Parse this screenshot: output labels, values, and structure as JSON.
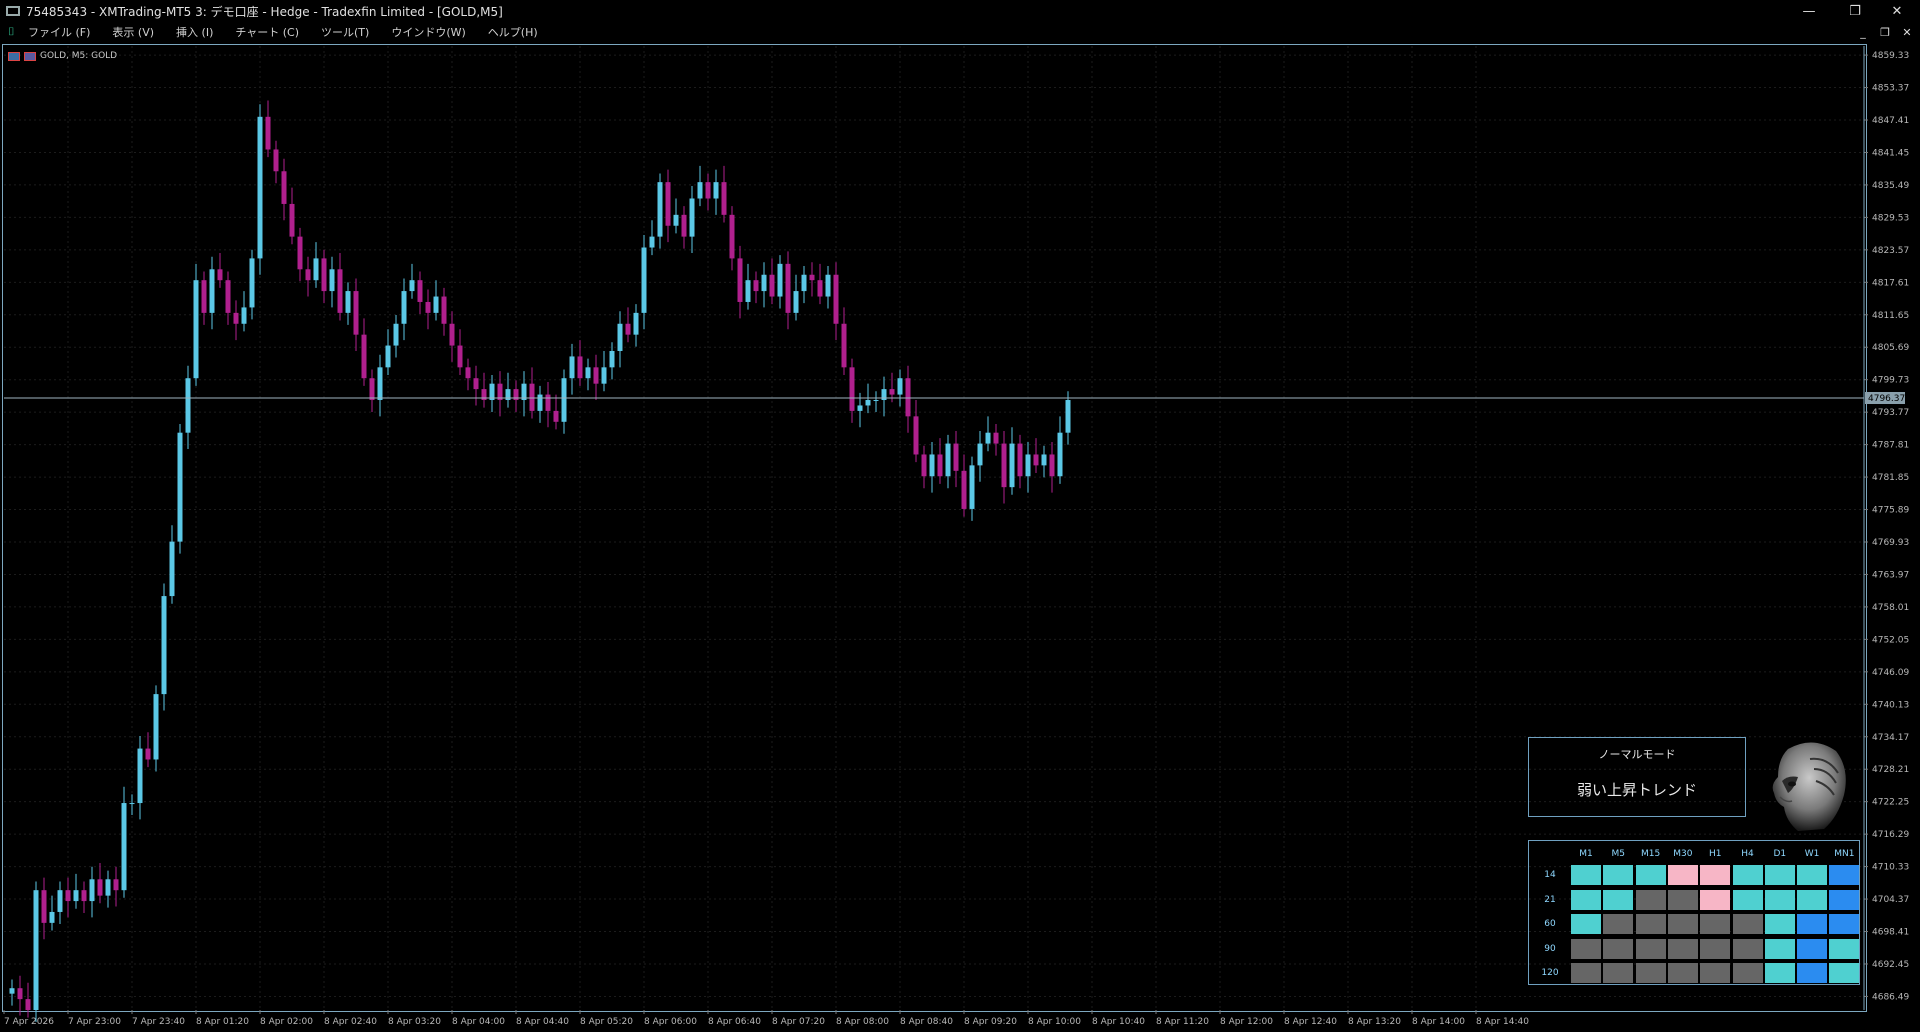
{
  "window": {
    "title": "75485343 - XMTrading-MT5 3: デモ口座 - Hedge - Tradexfin Limited - [GOLD,M5]",
    "controls": [
      "—",
      "❐",
      "✕"
    ]
  },
  "menu": {
    "items": [
      "ファイル (F)",
      "表示 (V)",
      "挿入 (I)",
      "チャート (C)",
      "ツール(T)",
      "ウインドウ(W)",
      "ヘルプ(H)"
    ],
    "mdi_controls": [
      "_",
      "❐",
      "✕"
    ]
  },
  "chart_label": "GOLD, M5:  GOLD",
  "current_price": "4796.37",
  "colors": {
    "bull": "#5bc8e6",
    "bear": "#b0208e",
    "grid": "#1c1c1c",
    "axis_text": "#b8b8b8",
    "price_line": "#9fb4c0",
    "cell_teal": "#4fd0d0",
    "cell_pink": "#f7b6c6",
    "cell_blue": "#2b8cf0",
    "cell_gray": "#666666",
    "header_text": "#8fd8ff"
  },
  "chart_data": {
    "type": "candlestick",
    "symbol": "GOLD",
    "timeframe": "M5",
    "y_ticks": [
      4859.33,
      4853.37,
      4847.41,
      4841.45,
      4835.49,
      4829.53,
      4823.57,
      4817.61,
      4811.65,
      4805.69,
      4799.73,
      4793.77,
      4787.81,
      4781.85,
      4775.89,
      4769.93,
      4763.97,
      4758.01,
      4752.05,
      4746.09,
      4740.13,
      4734.17,
      4728.21,
      4722.25,
      4716.29,
      4710.33,
      4704.37,
      4698.41,
      4692.45,
      4686.49
    ],
    "x_ticks": [
      "7 Apr 2026",
      "7 Apr 23:00",
      "7 Apr 23:40",
      "8 Apr 01:20",
      "8 Apr 02:00",
      "8 Apr 02:40",
      "8 Apr 03:20",
      "8 Apr 04:00",
      "8 Apr 04:40",
      "8 Apr 05:20",
      "8 Apr 06:00",
      "8 Apr 06:40",
      "8 Apr 07:20",
      "8 Apr 08:00",
      "8 Apr 08:40",
      "8 Apr 09:20",
      "8 Apr 10:00",
      "8 Apr 10:40",
      "8 Apr 11:20",
      "8 Apr 12:00",
      "8 Apr 12:40",
      "8 Apr 13:20",
      "8 Apr 14:00",
      "8 Apr 14:40"
    ],
    "ylim": [
      4684,
      4861
    ],
    "current_price": 4796.37,
    "closes": [
      4688,
      4686,
      4684,
      4706,
      4700,
      4702,
      4706,
      4704,
      4706,
      4704,
      4708,
      4705,
      4708,
      4706,
      4722,
      4722,
      4732,
      4730,
      4742,
      4760,
      4770,
      4790,
      4800,
      4818,
      4812,
      4820,
      4818,
      4812,
      4810,
      4813,
      4822,
      4848,
      4842,
      4838,
      4832,
      4826,
      4820,
      4818,
      4822,
      4816,
      4820,
      4812,
      4816,
      4808,
      4800,
      4796,
      4802,
      4806,
      4810,
      4816,
      4818,
      4814,
      4812,
      4815,
      4810,
      4806,
      4802,
      4800,
      4798,
      4796,
      4799,
      4796,
      4798,
      4796,
      4799,
      4794,
      4797,
      4794,
      4792,
      4800,
      4804,
      4800,
      4802,
      4799,
      4802,
      4805,
      4810,
      4808,
      4812,
      4824,
      4826,
      4836,
      4828,
      4830,
      4826,
      4833,
      4836,
      4833,
      4836,
      4830,
      4822,
      4814,
      4818,
      4816,
      4819,
      4815,
      4821,
      4812,
      4816,
      4819,
      4818,
      4815,
      4819,
      4810,
      4802,
      4794,
      4795,
      4796,
      4796,
      4798,
      4797,
      4800,
      4793,
      4786,
      4782,
      4786,
      4782,
      4788,
      4783,
      4776,
      4784,
      4788,
      4790,
      4788,
      4780,
      4788,
      4782,
      4786,
      4784,
      4786,
      4782,
      4790,
      4796
    ]
  },
  "mode_panel": {
    "title": "ノーマルモード",
    "value": "弱い上昇トレンド"
  },
  "trend_grid": {
    "columns": [
      "M1",
      "M5",
      "M15",
      "M30",
      "H1",
      "H4",
      "D1",
      "W1",
      "MN1"
    ],
    "rows": [
      {
        "label": "14",
        "cells": [
          "teal",
          "teal",
          "teal",
          "pink",
          "pink",
          "teal",
          "teal",
          "teal",
          "blue"
        ]
      },
      {
        "label": "21",
        "cells": [
          "teal",
          "teal",
          "gray",
          "gray",
          "pink",
          "teal",
          "teal",
          "teal",
          "blue"
        ]
      },
      {
        "label": "60",
        "cells": [
          "teal",
          "gray",
          "gray",
          "gray",
          "gray",
          "gray",
          "teal",
          "blue",
          "blue"
        ]
      },
      {
        "label": "90",
        "cells": [
          "gray",
          "gray",
          "gray",
          "gray",
          "gray",
          "gray",
          "teal",
          "blue",
          "teal"
        ]
      },
      {
        "label": "120",
        "cells": [
          "gray",
          "gray",
          "gray",
          "gray",
          "gray",
          "gray",
          "teal",
          "blue",
          "teal"
        ]
      }
    ]
  },
  "icons": {
    "app": "mt5-app-icon",
    "menu_logo": "chart-logo-icon",
    "chart_grid": "chart-grid-icon",
    "chart_symbol": "symbol-icon",
    "avatar": "robot-avatar-icon"
  }
}
